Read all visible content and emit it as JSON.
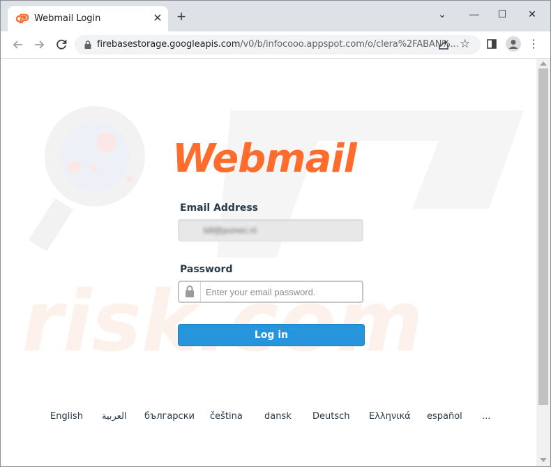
{
  "browser": {
    "tab_title": "Webmail Login",
    "new_tab_icon": "+",
    "window_controls": {
      "chevron": "⌄",
      "minimize": "—",
      "maximize": "☐",
      "close": "✕"
    },
    "url_host": "firebasestorage.googleapis.com",
    "url_rest": "/v0/b/infocooo.appspot.com/o/clera%2FABAN%..."
  },
  "page": {
    "logo_text": "Webmail",
    "email_label": "Email Address",
    "email_value": "bill@pumec.nl",
    "password_label": "Password",
    "password_placeholder": "Enter your email password.",
    "login_button": "Log in",
    "languages": [
      "English",
      "العربية",
      "български",
      "čeština",
      "dansk",
      "Deutsch",
      "Ελληνικά",
      "español",
      "..."
    ]
  },
  "colors": {
    "accent_blue": "#2795dc",
    "logo_orange": "#ff6c2c",
    "label_text": "#293a4a",
    "tabstrip_bg": "#dee1e6"
  },
  "icons": [
    "cpanel-favicon-icon",
    "close-icon",
    "plus-icon",
    "back-arrow-icon",
    "forward-arrow-icon",
    "reload-icon",
    "lock-icon",
    "share-icon",
    "star-icon",
    "side-panel-icon",
    "profile-icon",
    "kebab-menu-icon",
    "padlock-icon"
  ]
}
